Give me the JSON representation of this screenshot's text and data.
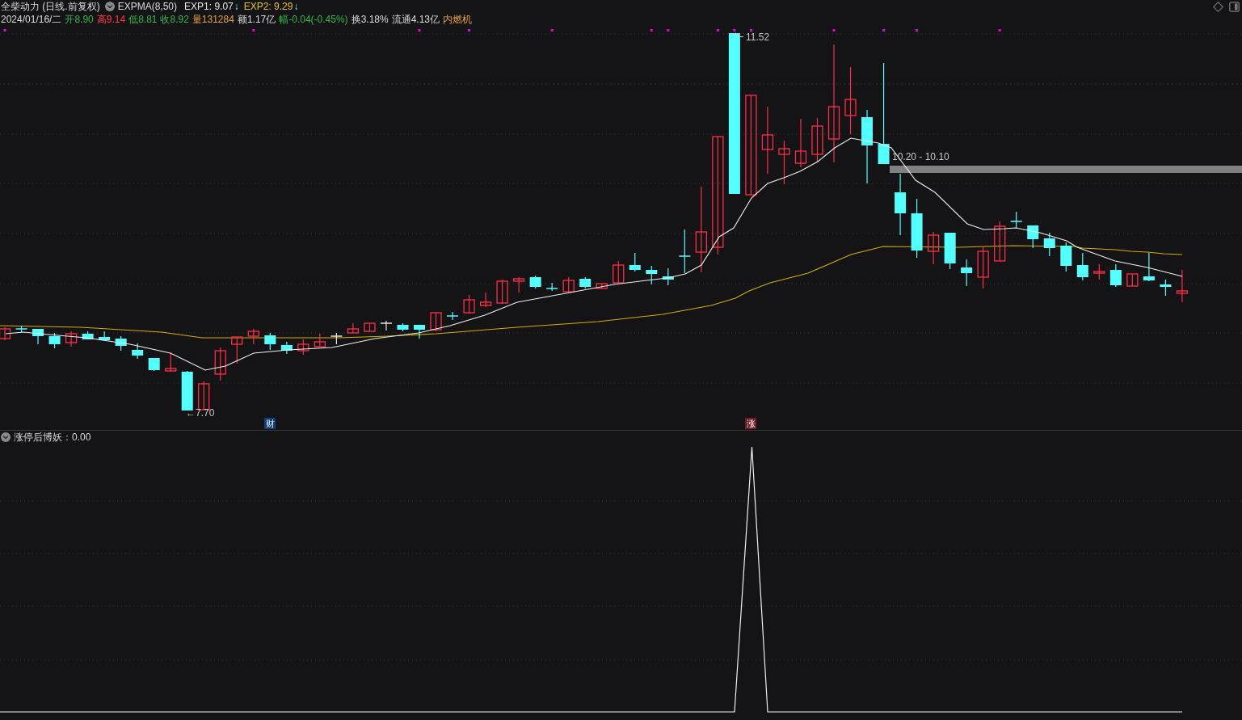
{
  "header": {
    "title": "全柴动力 (日线.前复权)",
    "indicator": "EXPMA(8,50)",
    "values": [
      {
        "label": "EXP1: 9.07",
        "color": "#e6e6e6",
        "arrow": "↓"
      },
      {
        "label": "EXP2: 9.29",
        "color": "#e8c21c",
        "arrow": "↓"
      }
    ]
  },
  "quote": [
    {
      "text": "2024/01/16/二",
      "color": "#dcdcdc"
    },
    {
      "text": "开8.90",
      "color": "#2db84d"
    },
    {
      "text": "高9.14",
      "color": "#ff3b47"
    },
    {
      "text": "低8.81",
      "color": "#2db84d"
    },
    {
      "text": "收8.92",
      "color": "#2db84d"
    },
    {
      "text": "量131284",
      "color": "#e6a23c"
    },
    {
      "text": "额1.17亿",
      "color": "#dcdcdc"
    },
    {
      "text": "幅-0.04(-0.45%)",
      "color": "#2db84d"
    },
    {
      "text": "换3.18%",
      "color": "#dcdcdc"
    },
    {
      "text": "流通4.13亿",
      "color": "#dcdcdc"
    },
    {
      "text": "内燃机",
      "color": "#e6a23c"
    }
  ],
  "price_chart": {
    "high_label": "11.52",
    "low_label": "←7.70",
    "band_label": "10.20 - 10.10",
    "event_tags": [
      {
        "text": "财",
        "kind": "finance"
      },
      {
        "text": "涨",
        "kind": "limit_up"
      }
    ]
  },
  "indicator_panel": {
    "title": "涨停后博妖：0.00"
  }
}
